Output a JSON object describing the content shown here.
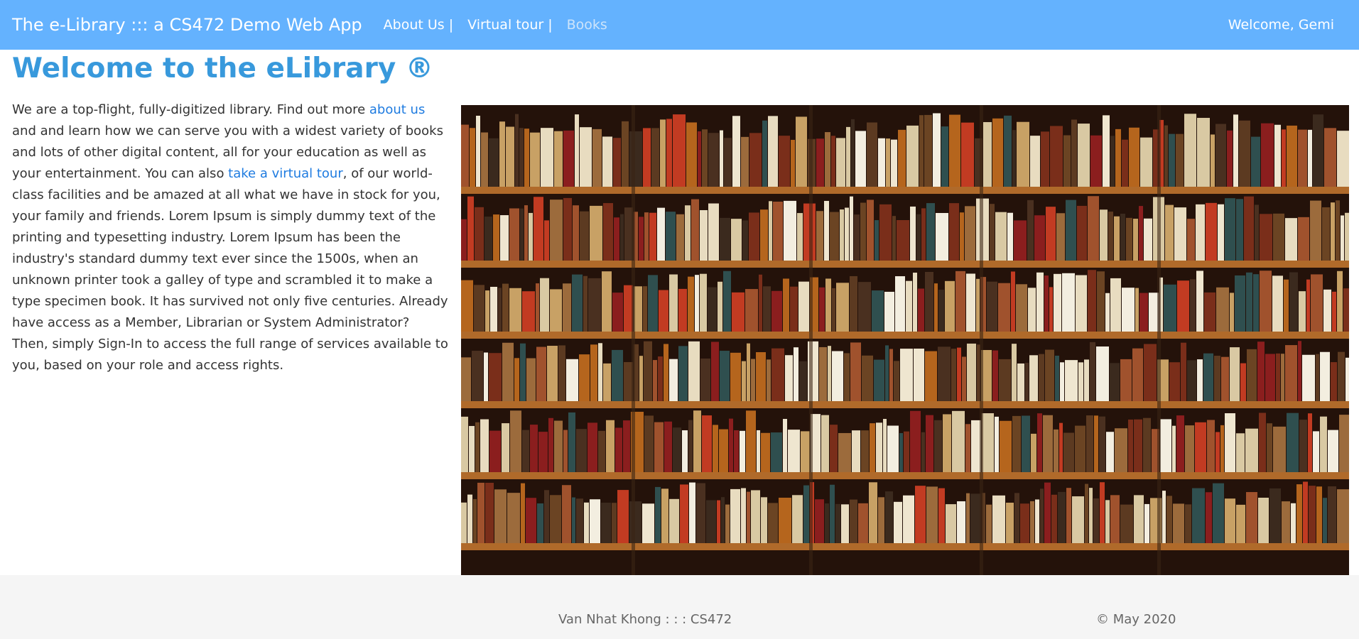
{
  "navbar": {
    "brand": "The e-Library ::: a CS472 Demo Web App",
    "items": [
      {
        "label": "About Us |"
      },
      {
        "label": "Virtual tour |"
      },
      {
        "label": "Books"
      }
    ],
    "welcome": "Welcome, Gemi",
    "background": "#64b2fe"
  },
  "main": {
    "title": "Welcome to the eLibrary ®",
    "intro": {
      "part1": "We are a top-flight, fully-digitized library. Find out more ",
      "link1": "about us",
      "part2": " and and learn how we can serve you with a widest variety of books and lots of other digital content, all for your education as well as your entertainment. You can also ",
      "link2": "take a virtual tour",
      "part3": ", of our world-class facilities and be amazed at all what we have in stock for you, your family and friends. Lorem Ipsum is simply dummy text of the printing and typesetting industry. Lorem Ipsum has been the industry's standard dummy text ever since the 1500s, when an unknown printer took a galley of type and scrambled it to make a type specimen book. It has survived not only five centuries. Already have access as a Member, Librarian or System Administrator? Then, simply Sign-In to access the full range of services available to you, based on your role and access rights."
    },
    "title_color": "#3899dc",
    "link_color": "#1e7be0"
  },
  "footer": {
    "author": "Van Nhat Khong : : : CS472",
    "date": "© May 2020"
  }
}
